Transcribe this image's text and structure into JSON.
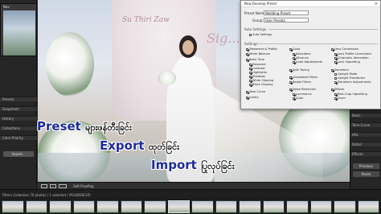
{
  "dialog": {
    "title": "New Develop Preset",
    "close_glyph": "×",
    "preset_name_label": "Preset Name:",
    "preset_name_value": "Wedding Preset",
    "group_label": "Group:",
    "group_value": "User Presets",
    "auto_settings_title": "Auto Settings",
    "auto_settings_item": "Auto Settings",
    "settings_title": "Settings",
    "col1": [
      "Treatment & Profile",
      "White Balance",
      "Basic Tone",
      "Exposure",
      "Contrast",
      "Highlights",
      "Shadows",
      "White Clipping",
      "Black Clipping",
      "Tone Curve",
      "Clarity"
    ],
    "col2": [
      "Color",
      "Saturation",
      "Vibrance",
      "Color Adjustments",
      "Split Toning",
      "Graduated Filters",
      "Radial Filters",
      "Noise Reduction",
      "Luminance",
      "Color"
    ],
    "col3": [
      "Lens Corrections",
      "Lens Profile Corrections",
      "Chromatic Aberration",
      "Lens Vignetting",
      "Transform",
      "Upright Mode",
      "Upright Transforms",
      "Transform Adjustments",
      "Effects",
      "Post-Crop Vignetting",
      "Grain"
    ]
  },
  "photo": {
    "backdrop_text": "Su Thiri Zaw",
    "ceremony_text": "Sig... Ceremony"
  },
  "overlay": {
    "line1_en": "Preset",
    "line1_mm": "များဖန်တီးခြင်း",
    "line2_en": "Export",
    "line2_mm": "ထုတ်ခြင်း",
    "line3_en": "Import",
    "line3_mm": "ပြုလုပ်ခြင်း"
  },
  "left_panel": {
    "navigator_label": "Nav",
    "sections": [
      "Presets",
      "Snapshots",
      "History",
      "Collections",
      "Color Priority"
    ],
    "import_button": "Import..."
  },
  "right_panel": {
    "sections": [
      "Basic",
      "Tone Curve",
      "HSL",
      "Detail",
      "Effects"
    ],
    "buttons": [
      "Previous",
      "Reset"
    ]
  },
  "toolbar": {
    "soft_proofing": "Soft Proofing"
  },
  "status": {
    "text": "Filters Collection   70 photos / 1 selected / #IG4DS6C(R)"
  }
}
